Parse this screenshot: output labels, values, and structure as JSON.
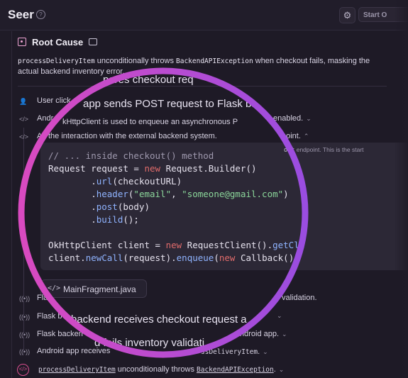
{
  "header": {
    "title": "Seer",
    "help_icon": "question-circle-icon",
    "settings_icon": "gear-icon",
    "start_label": "Start O"
  },
  "root_cause": {
    "title": "Root Cause",
    "icon": "target-icon",
    "feedback_icon": "chat-bubble-icon",
    "summary": {
      "method": "processDeliveryItem",
      "text1": " unconditionally throws ",
      "exception": "BackendAPIException",
      "text2": " when checkout fails, masking the actual backend inventory error."
    }
  },
  "overlays": {
    "compares": "pares checkout req",
    "post": "app sends POST request to Flask ba",
    "okhttp": "kHttpClient is used to enqueue an asynchronous P",
    "okhttp_tail": "enabled.",
    "interaction": "the interaction with the external backend system.",
    "backend_receives": "backend receives checkout request a",
    "fails": "d fails inventory validati"
  },
  "events": [
    {
      "icon": "user-icon",
      "text": "User click",
      "chevron": ""
    },
    {
      "icon": "code-icon",
      "text": "Andr",
      "chevron": "⌄"
    },
    {
      "icon": "code-icon",
      "text": "A",
      "suffix": "point.",
      "chevron": "⌃"
    },
    {
      "icon": "broadcast-icon",
      "text": "Fla",
      "suffix": "validation.",
      "chevron": ""
    },
    {
      "icon": "broadcast-icon",
      "text": "Flask b",
      "chevron": "⌄"
    },
    {
      "icon": "broadcast-icon",
      "text": "Flask backen",
      "suffix": "ndroid app.",
      "chevron": "⌄"
    },
    {
      "icon": "broadcast-icon",
      "text": "Android app receives",
      "suffix": "ssDeliveryItem",
      "suffix_end": ".",
      "chevron": "⌄"
    }
  ],
  "side_text": {
    "code": "out",
    "text": " endpoint. This is the start"
  },
  "code_block": {
    "comment": "// ... inside checkout() method",
    "line2_a": "Request request = ",
    "line2_kw": "new",
    "line2_b": " Request.Builder()",
    "indent": "        .",
    "url": "url",
    "url_arg": "(checkoutURL)",
    "header": "header",
    "header_s1": "\"email\"",
    "header_s2": "\"someone@gmail.com\"",
    "post": "post",
    "post_arg": "(body)",
    "build": "build",
    "build_arg": "();",
    "line8_a": "OkHttpClient client = ",
    "line8_kw": "new",
    "line8_b": " RequestClient().",
    "line8_fn": "getCli",
    "line9_a": "client.",
    "line9_fn1": "newCall",
    "line9_b": "(request).",
    "line9_fn2": "enqueue",
    "line9_c": "(",
    "line9_kw": "new",
    "line9_d": " Callback()"
  },
  "file_chip": {
    "icon": "code-icon",
    "name": "MainFragment.java"
  },
  "last_event": {
    "icon": "code-icon",
    "method": "processDeliveryItem",
    "text": " unconditionally throws ",
    "exception": "BackendAPIException",
    "end": "."
  }
}
